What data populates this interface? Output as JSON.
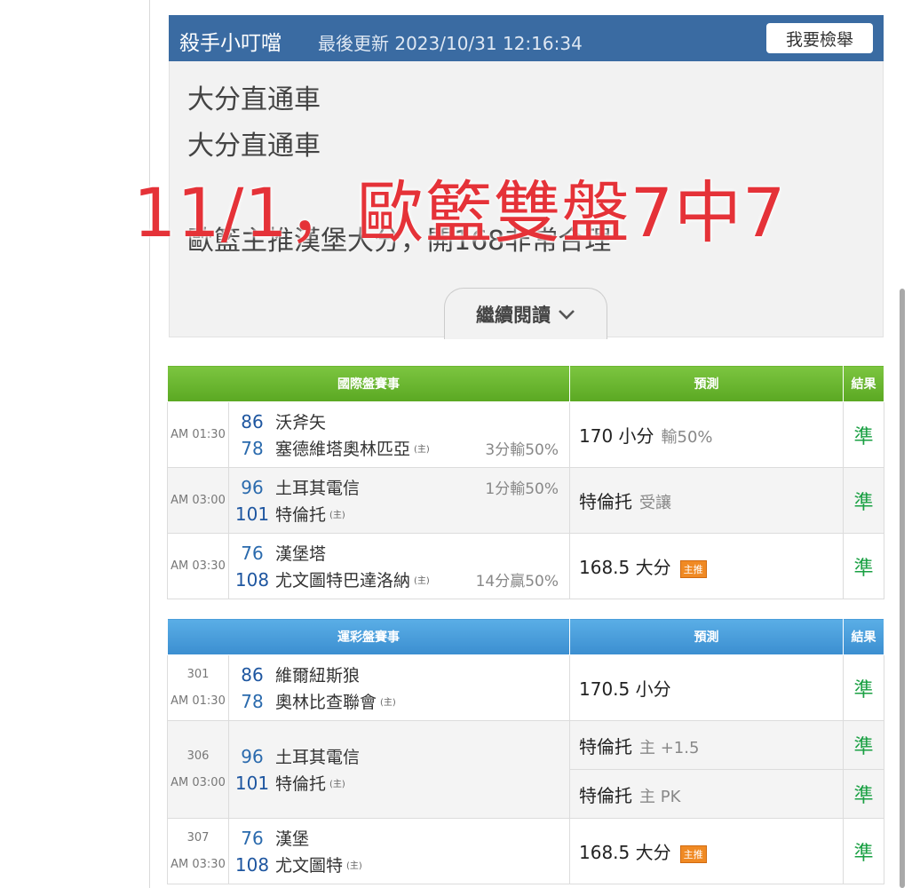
{
  "article": {
    "author": "殺手小叮噹",
    "updated": "最後更新 2023/10/31 12:16:34",
    "report_button": "我要檢舉",
    "lines": [
      "大分直通車",
      "大分直通車",
      "歐籃主推漢堡大分，開168非常合理"
    ],
    "overlay": "11/1，歐籃雙盤7中7",
    "read_more": "繼續閱讀"
  },
  "intl_table": {
    "headers": [
      "國際盤賽事",
      "預測",
      "結果"
    ],
    "rows": [
      {
        "time": "AM 01:30",
        "away_score": "86",
        "away_team": "沃斧矢",
        "home_score": "78",
        "home_team": "塞德維塔奧林匹亞",
        "home_tag": "(主)",
        "handicap": "3分輸50%",
        "prediction": "170 小分",
        "prediction_note": "輸50%",
        "result": "準"
      },
      {
        "time": "AM 03:00",
        "away_score": "96",
        "away_team": "土耳其電信",
        "home_score": "101",
        "home_team": "特倫托",
        "home_tag": "(主)",
        "handicap": "1分輸50%",
        "prediction": "特倫托",
        "prediction_note": "受讓",
        "result": "準"
      },
      {
        "time": "AM 03:30",
        "away_score": "76",
        "away_team": "漢堡塔",
        "home_score": "108",
        "home_team": "尤文圖特巴達洛納",
        "home_tag": "(主)",
        "handicap": "14分贏50%",
        "prediction": "168.5 大分",
        "badge": "主推",
        "result": "準"
      }
    ]
  },
  "lottery_table": {
    "headers": [
      "運彩盤賽事",
      "預測",
      "結果"
    ],
    "rows": [
      {
        "number": "301",
        "time": "AM 01:30",
        "away_score": "86",
        "away_team": "維爾紐斯狼",
        "home_score": "78",
        "home_team": "奧林比查聯會",
        "home_tag": "(主)",
        "predictions": [
          {
            "text": "170.5 小分",
            "note": "",
            "result": "準"
          }
        ]
      },
      {
        "number": "306",
        "time": "AM 03:00",
        "away_score": "96",
        "away_team": "土耳其電信",
        "home_score": "101",
        "home_team": "特倫托",
        "home_tag": "(主)",
        "predictions": [
          {
            "text": "特倫托",
            "note": "主 +1.5",
            "result": "準"
          },
          {
            "text": "特倫托",
            "note": "主 PK",
            "result": "準"
          }
        ]
      },
      {
        "number": "307",
        "time": "AM 03:30",
        "away_score": "76",
        "away_team": "漢堡",
        "home_score": "108",
        "home_team": "尤文圖特",
        "home_tag": "(主)",
        "predictions": [
          {
            "text": "168.5 大分",
            "note": "",
            "badge": "主推",
            "result": "準"
          }
        ]
      }
    ]
  }
}
